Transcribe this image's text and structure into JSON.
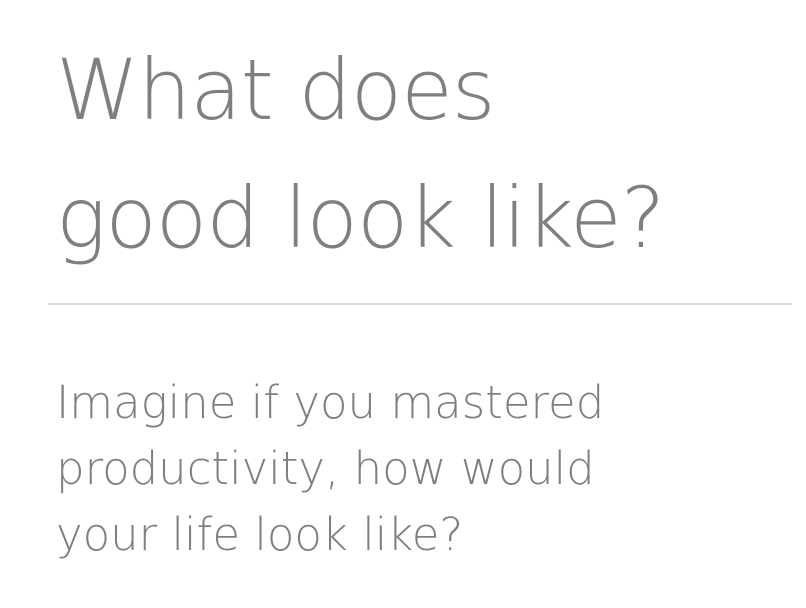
{
  "slide": {
    "title_lines": [
      "What does",
      "good look like?"
    ],
    "subtitle_lines": [
      "Imagine if you mastered",
      "productivity, how would",
      "your life look like?"
    ]
  }
}
